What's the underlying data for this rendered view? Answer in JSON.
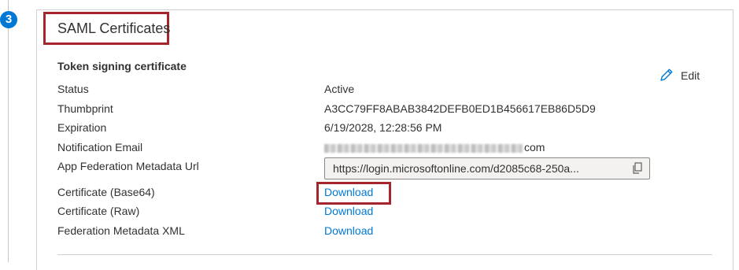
{
  "step": {
    "number": "3"
  },
  "section": {
    "title": "SAML Certificates"
  },
  "token_signing": {
    "heading": "Token signing certificate",
    "edit_label": "Edit"
  },
  "fields": {
    "status": {
      "label": "Status",
      "value": "Active"
    },
    "thumbprint": {
      "label": "Thumbprint",
      "value": "A3CC79FF8ABAB3842DEFB0ED1B456617EB86D5D9"
    },
    "expiration": {
      "label": "Expiration",
      "value": "6/19/2028, 12:28:56 PM"
    },
    "notification_email": {
      "label": "Notification Email",
      "value_visible_suffix": "com"
    },
    "metadata_url": {
      "label": "App Federation Metadata Url",
      "value": "https://login.microsoftonline.com/d2085c68-250a..."
    },
    "cert_base64": {
      "label": "Certificate (Base64)",
      "link": "Download"
    },
    "cert_raw": {
      "label": "Certificate (Raw)",
      "link": "Download"
    },
    "federation_xml": {
      "label": "Federation Metadata XML",
      "link": "Download"
    }
  },
  "icons": {
    "edit": "pencil-icon",
    "copy": "copy-icon"
  },
  "colors": {
    "accent": "#0078d4",
    "highlight": "#a4262c",
    "text": "#323130"
  }
}
